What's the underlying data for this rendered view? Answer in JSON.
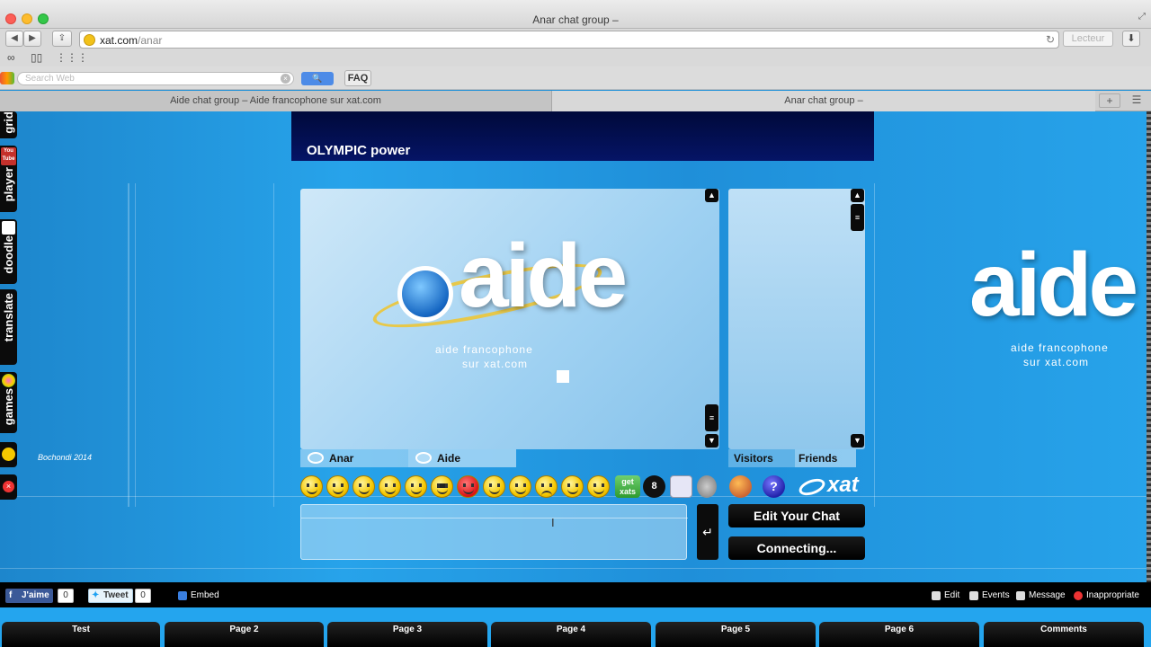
{
  "window": {
    "title": "Anar chat group –"
  },
  "browser": {
    "url_host": "xat.com",
    "url_path": "/anar",
    "reader_label": "Lecteur",
    "search_placeholder": "Search Web",
    "faq_label": "FAQ",
    "tabs": [
      {
        "label": "Aide chat group – Aide francophone sur xat.com"
      },
      {
        "label": "Anar chat group –"
      }
    ]
  },
  "side_gadgets": [
    {
      "label": "grid"
    },
    {
      "label": "player"
    },
    {
      "label": "doodle"
    },
    {
      "label": "translate"
    },
    {
      "label": "games"
    }
  ],
  "side_youtube_label": "You Tube",
  "header": {
    "title": "OLYMPIC power"
  },
  "chat": {
    "logo_word": "aide",
    "logo_sub1": "aide francophone",
    "logo_sub2": "sur xat.com",
    "signature": "Bochondi 2014",
    "tabs": [
      {
        "label": "Anar"
      },
      {
        "label": "Aide"
      }
    ],
    "user_tabs": [
      {
        "label": "Visitors"
      },
      {
        "label": "Friends"
      }
    ],
    "get_xats": "get xats",
    "brand": "xat",
    "edit_button": "Edit Your Chat",
    "status_button": "Connecting...",
    "enter_symbol": "↵"
  },
  "social": {
    "like_label": "J'aime",
    "like_count": "0",
    "tweet_label": "Tweet",
    "tweet_count": "0",
    "embed_label": "Embed",
    "edit_label": "Edit",
    "events_label": "Events",
    "message_label": "Message",
    "inappropriate_label": "Inappropriate"
  },
  "page_tabs": [
    {
      "label": "Test"
    },
    {
      "label": "Page 2"
    },
    {
      "label": "Page 3"
    },
    {
      "label": "Page 4"
    },
    {
      "label": "Page 5"
    },
    {
      "label": "Page 6"
    },
    {
      "label": "Comments"
    }
  ]
}
